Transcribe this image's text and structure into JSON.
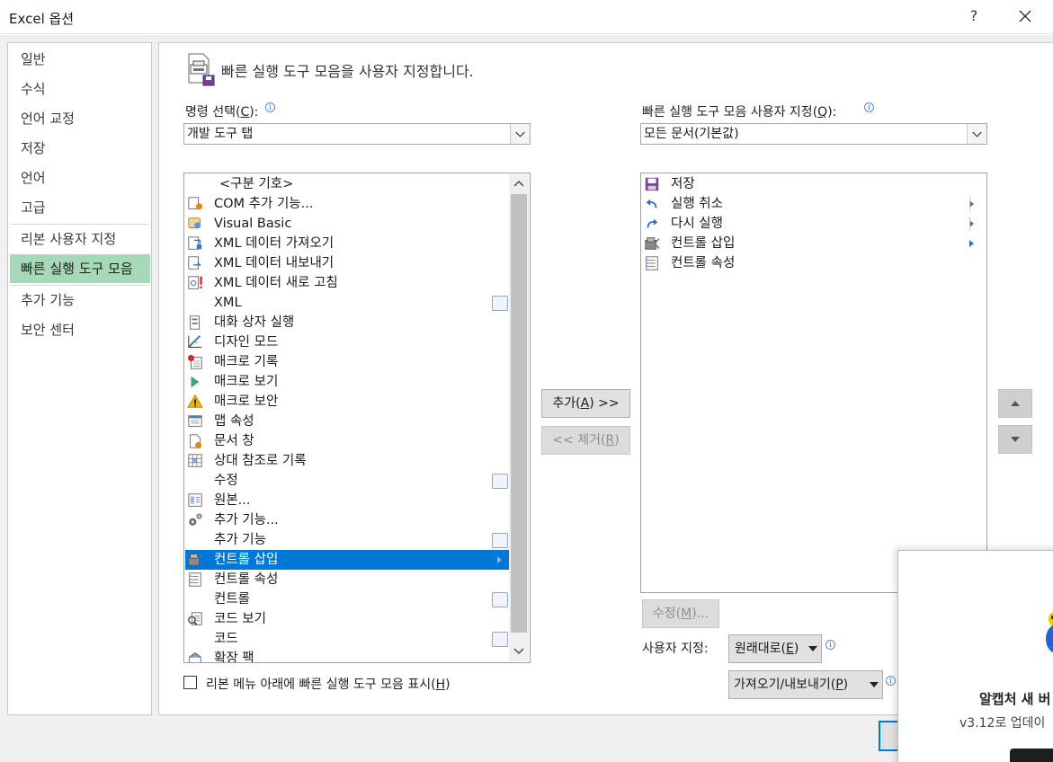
{
  "window": {
    "title": "Excel 옵션",
    "help": "?",
    "close": "✕"
  },
  "nav": {
    "items": [
      {
        "label": "일반"
      },
      {
        "label": "수식"
      },
      {
        "label": "언어 교정"
      },
      {
        "label": "저장"
      },
      {
        "label": "언어"
      },
      {
        "label": "고급"
      },
      {
        "label": "리본 사용자 지정"
      },
      {
        "label": "빠른 실행 도구 모음",
        "selected": true
      },
      {
        "label": "추가 기능"
      },
      {
        "label": "보안 센터"
      }
    ]
  },
  "main": {
    "header": "빠른 실행 도구 모음을 사용자 지정합니다.",
    "choose_label": "명령 선택(",
    "choose_key": "C",
    "choose_label_end": "):",
    "choose_value": "개발 도구 탭",
    "customize_label": "빠른 실행 도구 모음 사용자 지정(",
    "customize_key": "Q",
    "customize_label_end": "):",
    "customize_value": "모든 문서(기본값)",
    "commands": [
      {
        "label": "<구분 기호>",
        "icon": "none"
      },
      {
        "label": "COM 추가 기능...",
        "icon": "com-addin-icon"
      },
      {
        "label": "Visual Basic",
        "icon": "visual-basic-icon"
      },
      {
        "label": "XML 데이터 가져오기",
        "icon": "xml-import-icon"
      },
      {
        "label": "XML 데이터 내보내기",
        "icon": "xml-export-icon"
      },
      {
        "label": "XML 데이터 새로 고침",
        "icon": "xml-refresh-icon"
      },
      {
        "label": "XML",
        "icon": "none",
        "gallery": true
      },
      {
        "label": "대화 상자 실행",
        "icon": "dialog-icon"
      },
      {
        "label": "디자인 모드",
        "icon": "design-mode-icon"
      },
      {
        "label": "매크로 기록",
        "icon": "record-macro-icon"
      },
      {
        "label": "매크로 보기",
        "icon": "play-icon"
      },
      {
        "label": "매크로 보안",
        "icon": "warning-icon"
      },
      {
        "label": "맵 속성",
        "icon": "map-properties-icon"
      },
      {
        "label": "문서 창",
        "icon": "document-panel-icon"
      },
      {
        "label": "상대 참조로 기록",
        "icon": "relative-reference-icon"
      },
      {
        "label": "수정",
        "icon": "none",
        "gallery": true
      },
      {
        "label": "원본...",
        "icon": "source-icon"
      },
      {
        "label": "추가 기능...",
        "icon": "gears-icon"
      },
      {
        "label": "추가 기능",
        "icon": "none",
        "gallery": true
      },
      {
        "label": "컨트롤 삽입",
        "icon": "insert-control-icon",
        "selected": true,
        "submenu": true
      },
      {
        "label": "컨트롤 속성",
        "icon": "control-properties-icon"
      },
      {
        "label": "컨트롤",
        "icon": "none",
        "gallery": true
      },
      {
        "label": "코드 보기",
        "icon": "view-code-icon"
      },
      {
        "label": "코드",
        "icon": "none",
        "gallery": true
      },
      {
        "label": "확장 팩",
        "icon": "expansion-pack-icon"
      }
    ],
    "toolbar_items": [
      {
        "label": "저장",
        "icon": "save-icon"
      },
      {
        "label": "실행 취소",
        "icon": "undo-icon",
        "submenu": true
      },
      {
        "label": "다시 실행",
        "icon": "redo-icon",
        "submenu": true
      },
      {
        "label": "컨트롤 삽입",
        "icon": "insert-control-icon",
        "submenu": true
      },
      {
        "label": "컨트롤 속성",
        "icon": "control-properties-icon"
      }
    ],
    "add_label": "추가(",
    "add_key": "A",
    "add_label_end": ") >>",
    "remove_label": "<< 제거(",
    "remove_key": "R",
    "remove_label_end": ")",
    "modify_label": "수정(",
    "modify_key": "M",
    "modify_label_end": ")...",
    "custom_label": "사용자 지정:",
    "reset_label": "원래대로(",
    "reset_key": "E",
    "reset_label_end": ")",
    "import_label": "가져오기/내보내기(",
    "import_key": "P",
    "import_label_end": ")",
    "show_below_label": "리본 메뉴 아래에 빠른 실행 도구 모음 표시(",
    "show_below_key": "H",
    "show_below_label_end": ")"
  },
  "popup": {
    "title": "알캡처 새 버",
    "subtitle": "v3.12로 업데이"
  },
  "colors": {
    "selection": "#0078d7",
    "nav_selected": "#a6d9b8",
    "dialog_bg": "#f0f0f0"
  }
}
